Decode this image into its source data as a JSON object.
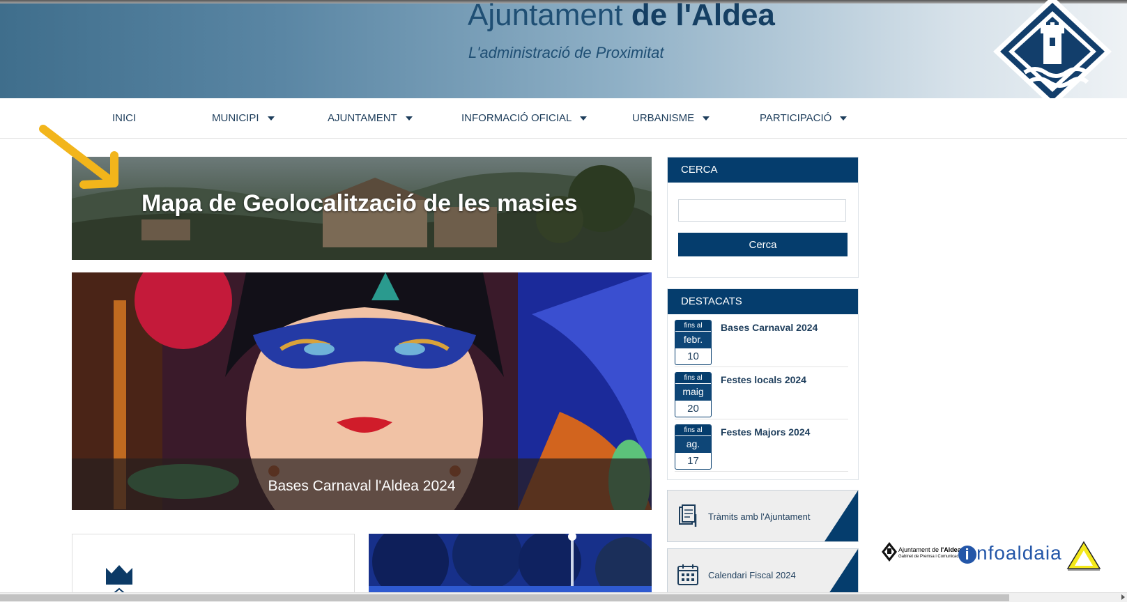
{
  "header": {
    "title_part1": "Ajuntament",
    "title_part2": "de l'Aldea",
    "tagline": "L'administració de Proximitat"
  },
  "nav": {
    "items": [
      {
        "label": "INICI"
      },
      {
        "label": "MUNICIPI"
      },
      {
        "label": "AJUNTAMENT"
      },
      {
        "label": "INFORMACIÓ OFICIAL"
      },
      {
        "label": "URBANISME"
      },
      {
        "label": "PARTICIPACIÓ"
      }
    ]
  },
  "banners": {
    "mapa_title": "Mapa de Geolocalització de les masies",
    "carnaval_caption": "Bases Carnaval l'Aldea 2024"
  },
  "search": {
    "heading": "CERCA",
    "value": "",
    "button_label": "Cerca"
  },
  "destacats": {
    "heading": "DESTACATS",
    "items": [
      {
        "prefix": "fins al",
        "month": "febr.",
        "day": "10",
        "title": "Bases Carnaval 2024"
      },
      {
        "prefix": "fins al",
        "month": "maig",
        "day": "20",
        "title": "Festes locals 2024"
      },
      {
        "prefix": "fins al",
        "month": "ag.",
        "day": "17",
        "title": "Festes Majors 2024"
      }
    ]
  },
  "links": {
    "tramits": "Tràmits amb l'Ajuntament",
    "calendari": "Calendari Fiscal 2024"
  },
  "logos": {
    "ajuntament_line1": "Ajuntament de ",
    "ajuntament_bold": "l'Aldea",
    "ajuntament_line2": "Gabinet de Premsa i Comunicació",
    "infoaldaia": "nfoaldaia"
  },
  "colors": {
    "primary": "#053d6d",
    "nav_text": "#1d3d5b",
    "arrow": "#f2b51b"
  }
}
